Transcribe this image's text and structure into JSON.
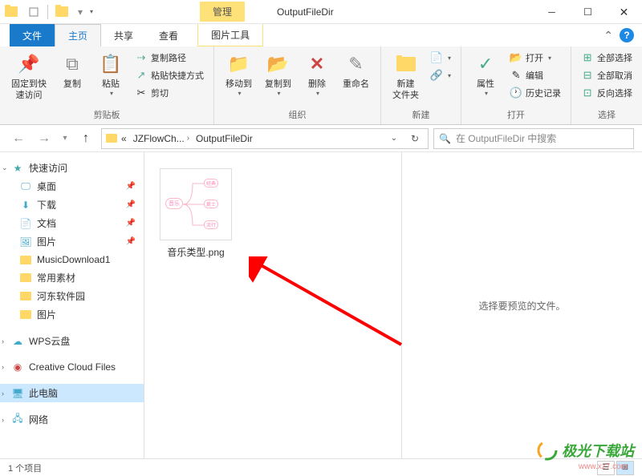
{
  "window": {
    "title": "OutputFileDir",
    "context_tab": "管理"
  },
  "tabs": {
    "file": "文件",
    "home": "主页",
    "share": "共享",
    "view": "查看",
    "picture_tools": "图片工具"
  },
  "ribbon": {
    "clipboard": {
      "label": "剪贴板",
      "pin": "固定到快\n速访问",
      "copy": "复制",
      "paste": "粘贴",
      "copy_path": "复制路径",
      "paste_shortcut": "粘贴快捷方式",
      "cut": "剪切"
    },
    "organize": {
      "label": "组织",
      "move_to": "移动到",
      "copy_to": "复制到",
      "delete": "删除",
      "rename": "重命名"
    },
    "new": {
      "label": "新建",
      "new_folder": "新建\n文件夹"
    },
    "open": {
      "label": "打开",
      "properties": "属性",
      "open": "打开",
      "edit": "编辑",
      "history": "历史记录"
    },
    "select": {
      "label": "选择",
      "select_all": "全部选择",
      "select_none": "全部取消",
      "invert": "反向选择"
    }
  },
  "breadcrumbs": {
    "b1": "JZFlowCh...",
    "b2": "OutputFileDir"
  },
  "search": {
    "placeholder": "在 OutputFileDir 中搜索"
  },
  "sidebar": {
    "quick_access": "快速访问",
    "desktop": "桌面",
    "downloads": "下载",
    "documents": "文档",
    "pictures": "图片",
    "music_dl": "MusicDownload1",
    "common": "常用素材",
    "hedong": "河东软件园",
    "pictures2": "图片",
    "wps": "WPS云盘",
    "ccf": "Creative Cloud Files",
    "this_pc": "此电脑",
    "network": "网络"
  },
  "files": {
    "item1": "音乐类型.png"
  },
  "preview": {
    "empty": "选择要预览的文件。"
  },
  "status": {
    "count": "1 个项目"
  },
  "thumb": {
    "root": "音乐",
    "n1": "经典",
    "n2": "爵士",
    "n3": "流行"
  },
  "watermark": {
    "text": "极光下载站",
    "url": "www.xz7.com"
  }
}
